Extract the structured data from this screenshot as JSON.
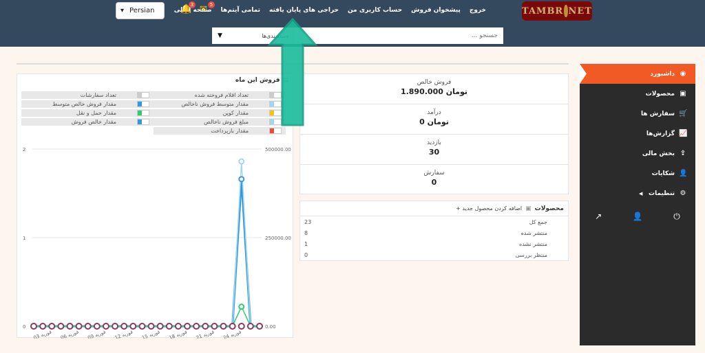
{
  "header": {
    "logo_text_left": "TAMBR",
    "logo_text_right": "NET",
    "nav": [
      "صفحه اصلی",
      "تمامی آیتم‌ها",
      "حراجی های پایان یافته",
      "حساب کاربری من",
      "پیشخوان فروش",
      "خروج"
    ],
    "notifications_count": "3",
    "messages_count": "5",
    "language": "Persian",
    "search_placeholder": "جستجو ...",
    "category_label": "دسته‌بندی‌ها"
  },
  "sidebar": {
    "items": [
      {
        "label": "داشبورد",
        "icon": "dashboard-icon"
      },
      {
        "label": "محصولات",
        "icon": "briefcase-icon"
      },
      {
        "label": "سفارش ها",
        "icon": "cart-icon"
      },
      {
        "label": "گزارش‌ها",
        "icon": "chart-icon"
      },
      {
        "label": "بخش مالی",
        "icon": "upload-icon"
      },
      {
        "label": "شکایات",
        "icon": "user-icon"
      },
      {
        "label": "تنظیمات",
        "icon": "gear-icon"
      }
    ]
  },
  "stats": [
    {
      "label": "فروش خالص",
      "value": "1.890.000 تومان"
    },
    {
      "label": "درآمد",
      "value": "0 تومان"
    },
    {
      "label": "بازدید",
      "value": "30"
    },
    {
      "label": "سفارش",
      "value": "0"
    }
  ],
  "products": {
    "title": "محصولات",
    "add_label": "+ اضافه کردن محصول جدید",
    "rows": [
      {
        "label": "جمع کل",
        "value": "23"
      },
      {
        "label": "منتشر شده",
        "value": "8"
      },
      {
        "label": "منتشر نشده",
        "value": "1"
      },
      {
        "label": "منتظر بررسی",
        "value": "0"
      }
    ]
  },
  "chart_card": {
    "title": "فروش این ماه",
    "legend": [
      [
        {
          "label": "تعداد اقلام فروخته شده",
          "color": "#cccccc"
        },
        {
          "label": "تعداد سفارشات",
          "color": "#cccccc"
        }
      ],
      [
        {
          "label": "مقدار متوسط فروش ناخالص",
          "color": "#9fd8f0"
        },
        {
          "label": "مقدار فروش خالص متوسط",
          "color": "#3498db"
        }
      ],
      [
        {
          "label": "مقدار کوپن",
          "color": "#f1c40f"
        },
        {
          "label": "مقدار حمل و نقل",
          "color": "#2ecc71"
        }
      ],
      [
        {
          "label": "مبلغ فروش ناخالص",
          "color": "#9fd8f0"
        },
        {
          "label": "مقدار خالص فروش",
          "color": "#3498db"
        }
      ],
      [
        {
          "label": "مقدار بازپرداخت",
          "color": "#e74c3c"
        },
        {
          "label": "",
          "color": ""
        }
      ]
    ]
  },
  "chart_data": {
    "type": "line",
    "x_tick_labels": [
      "03 فوریه",
      "06 فوریه",
      "09 فوریه",
      "12 فوریه",
      "15 فوریه",
      "18 فوریه",
      "21 فوریه",
      "24 فوریه"
    ],
    "x": [
      1,
      2,
      3,
      4,
      5,
      6,
      7,
      8,
      9,
      10,
      11,
      12,
      13,
      14,
      15,
      16,
      17,
      18,
      19,
      20,
      21,
      22,
      23,
      24,
      25,
      26
    ],
    "left_axis_ticks": [
      "0",
      "1",
      "2"
    ],
    "right_axis_ticks": [
      "0.00",
      "250000.00",
      "500000.00"
    ],
    "ylim_right": [
      0,
      500000
    ],
    "series": [
      {
        "color": "#3498db",
        "values": [
          0,
          0,
          0,
          0,
          0,
          0,
          0,
          0,
          0,
          0,
          0,
          0,
          0,
          0,
          0,
          0,
          0,
          0,
          0,
          0,
          0,
          0,
          0,
          415000,
          0,
          0
        ]
      },
      {
        "color": "#9fd8f0",
        "values": [
          0,
          0,
          0,
          0,
          0,
          0,
          0,
          0,
          0,
          0,
          0,
          0,
          0,
          0,
          0,
          0,
          0,
          0,
          0,
          0,
          0,
          0,
          0,
          465000,
          0,
          0
        ]
      },
      {
        "color": "#2ecc71",
        "values": [
          0,
          0,
          0,
          0,
          0,
          0,
          0,
          0,
          0,
          0,
          0,
          0,
          0,
          0,
          0,
          0,
          0,
          0,
          0,
          0,
          0,
          0,
          0,
          55000,
          0,
          0
        ]
      }
    ],
    "grid": true
  }
}
